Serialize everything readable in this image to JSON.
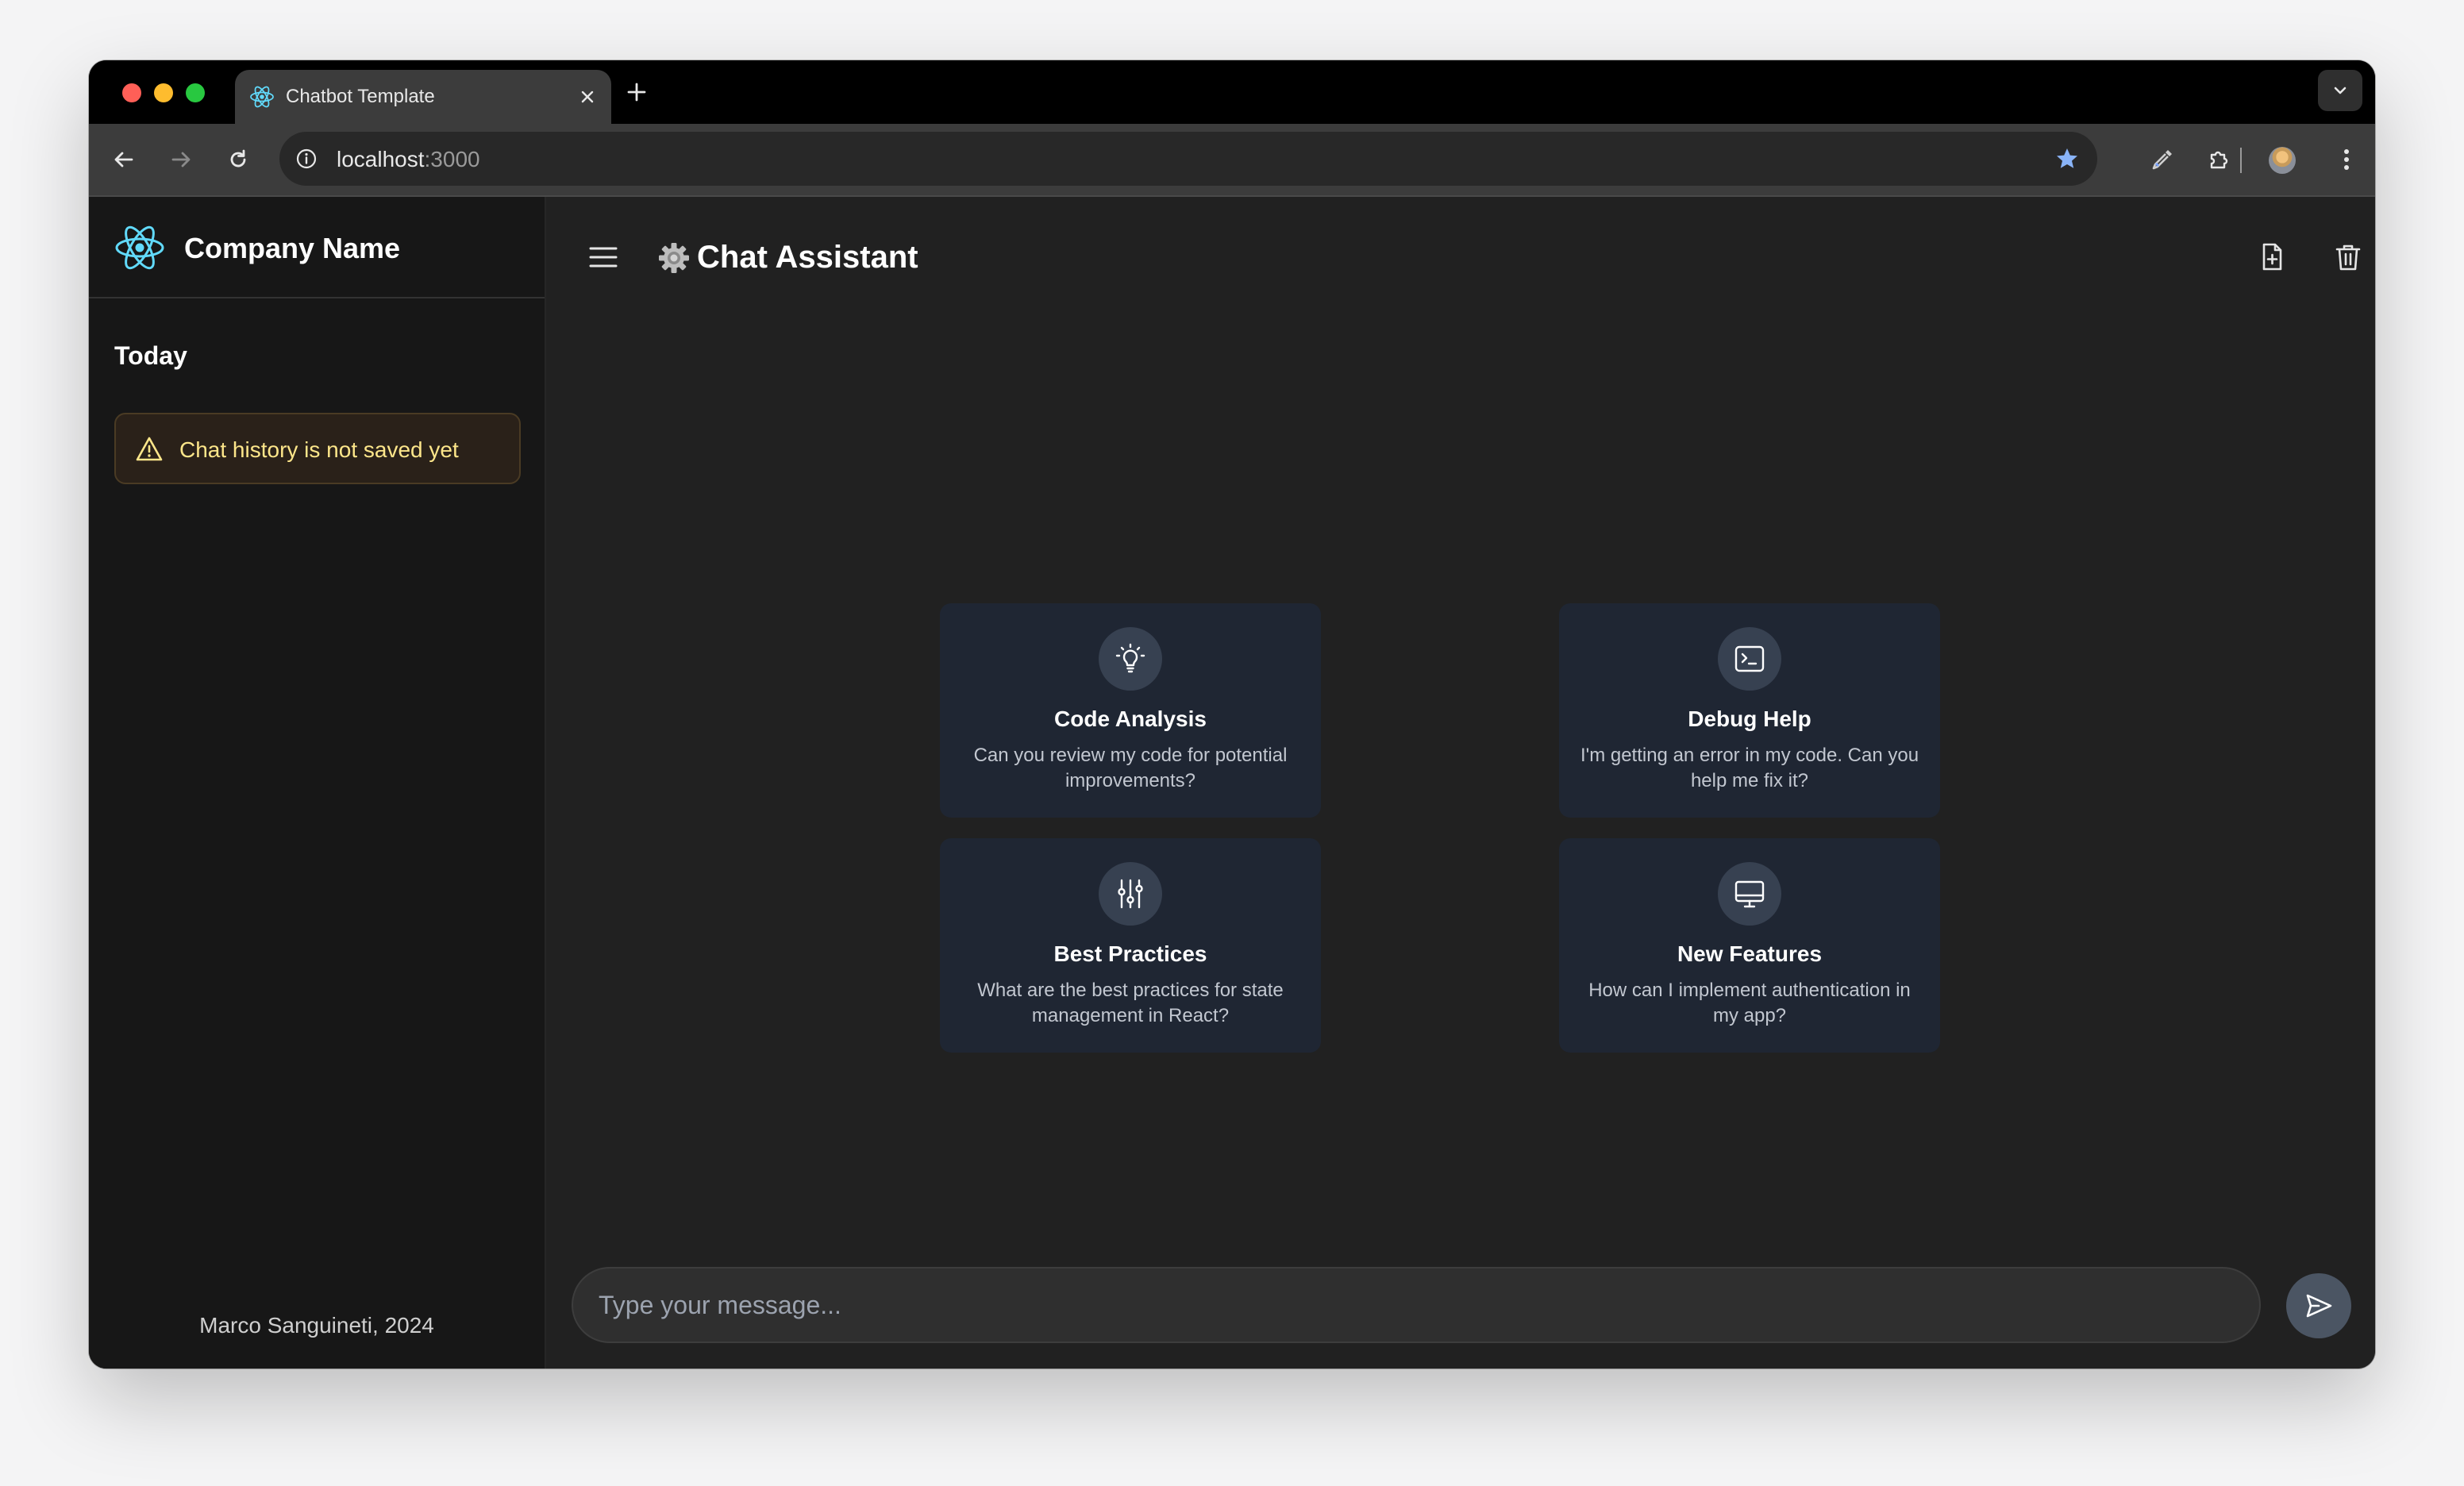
{
  "browser": {
    "tab_title": "Chatbot Template",
    "url_host": "localhost",
    "url_port": ":3000"
  },
  "sidebar": {
    "company_name": "Company Name",
    "section_title": "Today",
    "warning_text": "Chat history is not saved yet",
    "footer": "Marco Sanguineti, 2024"
  },
  "header": {
    "title": "Chat Assistant"
  },
  "suggestions": [
    {
      "icon": "lightbulb-icon",
      "title": "Code Analysis",
      "description": "Can you review my code for potential improvements?"
    },
    {
      "icon": "terminal-icon",
      "title": "Debug Help",
      "description": "I'm getting an error in my code. Can you help me fix it?"
    },
    {
      "icon": "sliders-icon",
      "title": "Best Practices",
      "description": "What are the best practices for state management in React?"
    },
    {
      "icon": "monitor-icon",
      "title": "New Features",
      "description": "How can I implement authentication in my app?"
    }
  ],
  "composer": {
    "placeholder": "Type your message...",
    "value": ""
  },
  "colors": {
    "app_background": "#212121",
    "sidebar_background": "#171717",
    "card_background": "#1f2633",
    "warning_text": "#fde68a",
    "send_button": "#4b5563"
  }
}
